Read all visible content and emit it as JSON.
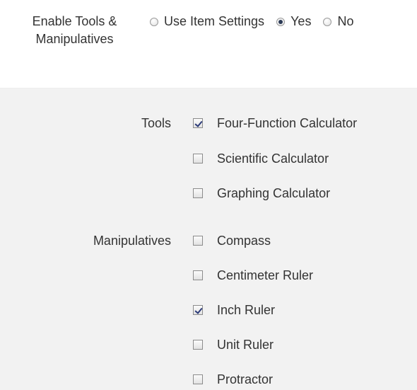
{
  "enable_section": {
    "label_line1": "Enable Tools &",
    "label_line2": "Manipulatives",
    "options": [
      {
        "label": "Use Item Settings",
        "selected": false
      },
      {
        "label": "Yes",
        "selected": true
      },
      {
        "label": "No",
        "selected": false
      }
    ]
  },
  "tools": {
    "label": "Tools",
    "items": [
      {
        "label": "Four-Function Calculator",
        "checked": true
      },
      {
        "label": "Scientific Calculator",
        "checked": false
      },
      {
        "label": "Graphing Calculator",
        "checked": false
      }
    ]
  },
  "manipulatives": {
    "label": "Manipulatives",
    "items": [
      {
        "label": "Compass",
        "checked": false
      },
      {
        "label": "Centimeter Ruler",
        "checked": false
      },
      {
        "label": "Inch Ruler",
        "checked": true
      },
      {
        "label": "Unit Ruler",
        "checked": false
      },
      {
        "label": "Protractor",
        "checked": false
      }
    ]
  }
}
